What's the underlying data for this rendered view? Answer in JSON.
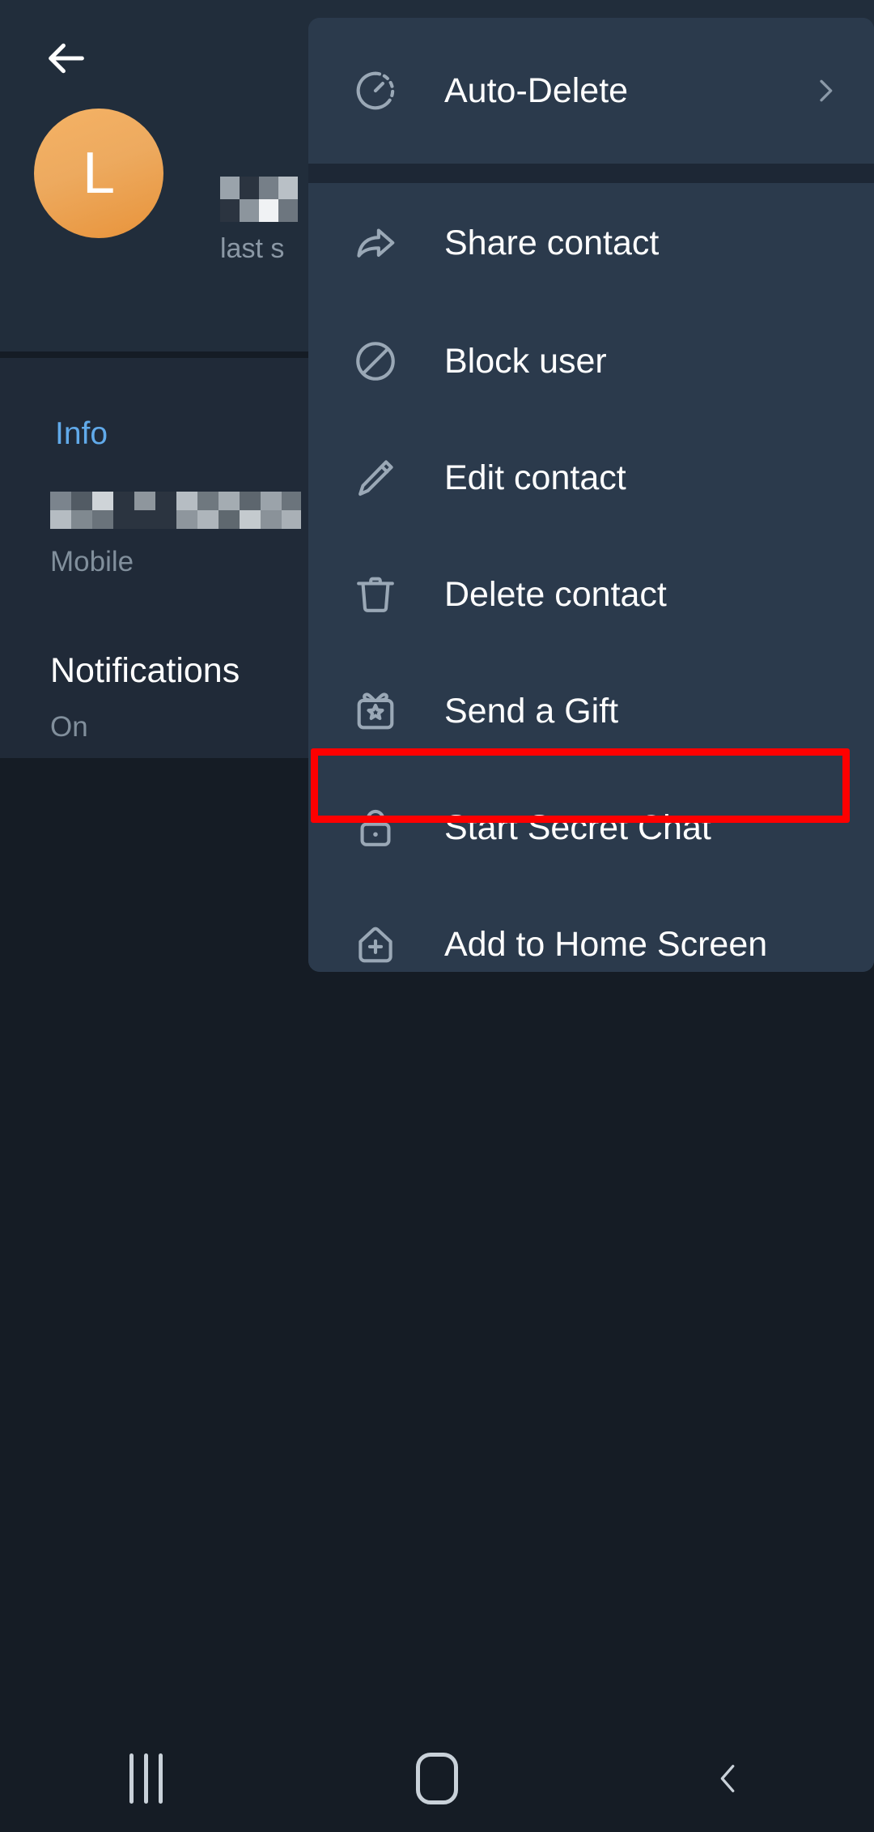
{
  "app": {
    "theme_bg": "#151c25",
    "card_bg": "#202a38",
    "header_bg": "#212d3b",
    "menu_bg": "#2b3a4c",
    "accent": "#61aaea",
    "highlight_color": "#fe0000",
    "avatar_color": "#eda254"
  },
  "header": {
    "back_icon": "back-arrow-icon",
    "avatar_initial": "L",
    "contact_name": "",
    "status": "last s"
  },
  "info": {
    "section_title": "Info",
    "phone_number": "",
    "phone_label": "Mobile",
    "notifications_title": "Notifications",
    "notifications_value": "On"
  },
  "menu": {
    "items": [
      {
        "label": "Auto-Delete",
        "icon": "auto-delete-timer-icon",
        "trailing": "chevron-right-icon",
        "highlighted": false
      },
      {
        "label": "Share contact",
        "icon": "share-arrow-icon",
        "trailing": "",
        "highlighted": false
      },
      {
        "label": "Block user",
        "icon": "block-user-icon",
        "trailing": "",
        "highlighted": false
      },
      {
        "label": "Edit contact",
        "icon": "pencil-edit-icon",
        "trailing": "",
        "highlighted": false
      },
      {
        "label": "Delete contact",
        "icon": "trash-delete-icon",
        "trailing": "",
        "highlighted": false
      },
      {
        "label": "Send a Gift",
        "icon": "gift-icon",
        "trailing": "",
        "highlighted": false
      },
      {
        "label": "Start Secret Chat",
        "icon": "lock-icon",
        "trailing": "",
        "highlighted": true
      },
      {
        "label": "Add to Home Screen",
        "icon": "home-plus-icon",
        "trailing": "",
        "highlighted": false
      }
    ]
  },
  "navbar": {
    "recents_label": "recents-icon",
    "home_label": "home-icon",
    "back_label": "back-icon"
  }
}
